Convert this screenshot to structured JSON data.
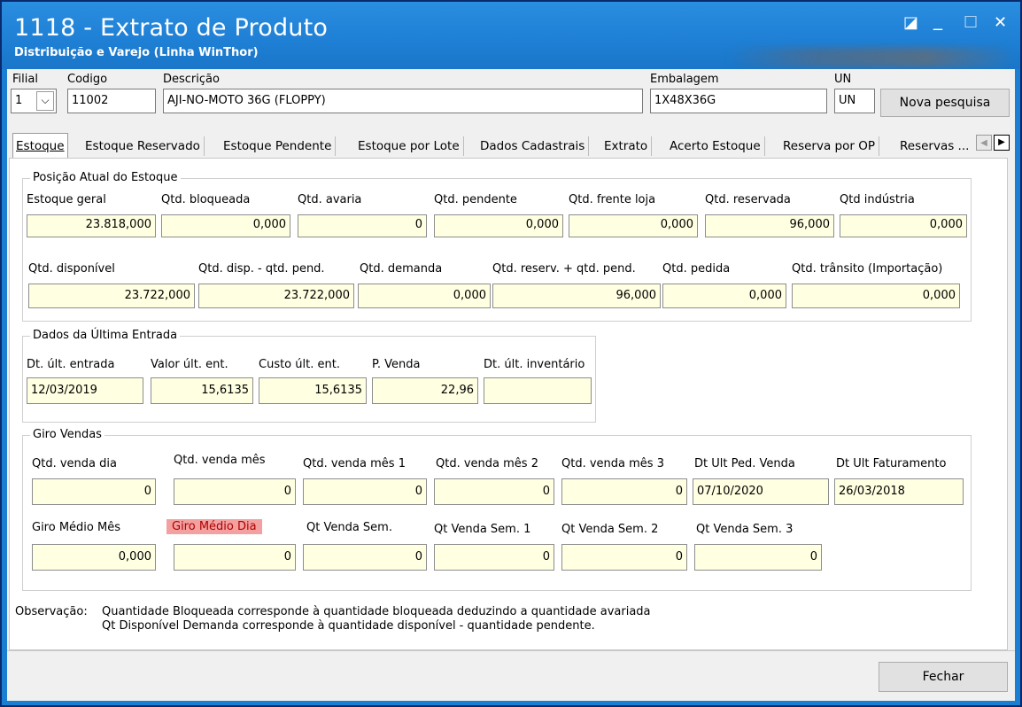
{
  "window": {
    "title": "1118 - Extrato de Produto",
    "subtitle": "Distribuição e Varejo (Linha WinThor)",
    "controls": {
      "restore": "◪",
      "minimize": "_",
      "maximize": "☐",
      "close": "✕"
    }
  },
  "header": {
    "filial": {
      "label": "Filial",
      "value": "1",
      "dropdown_glyph": "⌵"
    },
    "codigo": {
      "label": "Codigo",
      "value": "11002"
    },
    "descricao": {
      "label": "Descrição",
      "value": "AJI-NO-MOTO 36G (FLOPPY)"
    },
    "embalagem": {
      "label": "Embalagem",
      "value": "1X48X36G"
    },
    "un": {
      "label": "UN",
      "value": "UN"
    },
    "nova_pesquisa": "Nova pesquisa"
  },
  "tabs": [
    {
      "label": "Estoque",
      "active": true
    },
    {
      "label": "Estoque Reservado"
    },
    {
      "label": "Estoque Pendente"
    },
    {
      "label": "Estoque por Lote"
    },
    {
      "label": "Dados Cadastrais"
    },
    {
      "label": "Extrato"
    },
    {
      "label": "Acerto Estoque"
    },
    {
      "label": "Reserva por OP"
    },
    {
      "label": "Reservas ..."
    }
  ],
  "tab_scroll": {
    "left": "◀",
    "right": "▶"
  },
  "posicao": {
    "title": "Posição Atual do Estoque",
    "row1": [
      {
        "label": "Estoque geral",
        "value": "23.818,000"
      },
      {
        "label": "Qtd. bloqueada",
        "value": "0,000"
      },
      {
        "label": "Qtd. avaria",
        "value": "0"
      },
      {
        "label": "Qtd. pendente",
        "value": "0,000"
      },
      {
        "label": "Qtd. frente loja",
        "value": "0,000"
      },
      {
        "label": "Qtd. reservada",
        "value": "96,000"
      },
      {
        "label": "Qtd indústria",
        "value": "0,000"
      }
    ],
    "row2": [
      {
        "label": "Qtd. disponível",
        "value": "23.722,000"
      },
      {
        "label": "Qtd. disp. - qtd. pend.",
        "value": "23.722,000"
      },
      {
        "label": "Qtd. demanda",
        "value": "0,000"
      },
      {
        "label": "Qtd. reserv. + qtd. pend.",
        "value": "96,000"
      },
      {
        "label": "Qtd. pedida",
        "value": "0,000"
      },
      {
        "label": "Qtd. trânsito (Importação)",
        "value": "0,000"
      }
    ]
  },
  "ultima_entrada": {
    "title": "Dados da Última Entrada",
    "fields": [
      {
        "label": "Dt. últ. entrada",
        "value": "12/03/2019"
      },
      {
        "label": "Valor últ. ent.",
        "value": "15,6135"
      },
      {
        "label": "Custo últ. ent.",
        "value": "15,6135"
      },
      {
        "label": "P. Venda",
        "value": "22,96"
      },
      {
        "label": "Dt. últ. inventário",
        "value": ""
      }
    ]
  },
  "giro": {
    "title": "Giro Vendas",
    "row1": [
      {
        "label": "Qtd. venda dia",
        "value": "0"
      },
      {
        "label": "Qtd. venda mês",
        "value": "0"
      },
      {
        "label": "Qtd. venda mês 1",
        "value": "0"
      },
      {
        "label": "Qtd. venda mês 2",
        "value": "0"
      },
      {
        "label": "Qtd. venda mês 3",
        "value": "0"
      },
      {
        "label": "Dt Ult Ped. Venda",
        "value": "07/10/2020"
      },
      {
        "label": "Dt Ult Faturamento",
        "value": "26/03/2018"
      }
    ],
    "row2": [
      {
        "label": "Giro Médio Mês",
        "value": "0,000"
      },
      {
        "label": "Giro Médio Dia",
        "value": "0",
        "highlight_color": "#f3a0a0"
      },
      {
        "label": "Qt Venda Sem.",
        "value": "0"
      },
      {
        "label": "Qt Venda Sem. 1",
        "value": "0"
      },
      {
        "label": "Qt Venda Sem. 2",
        "value": "0"
      },
      {
        "label": "Qt Venda Sem. 3",
        "value": "0"
      }
    ]
  },
  "observacao": {
    "label": "Observação:",
    "line1": "Quantidade Bloqueada corresponde à quantidade bloqueada deduzindo a quantidade avariada",
    "line2": "Qt Disponível Demanda corresponde à quantidade disponível - quantidade pendente."
  },
  "footer": {
    "fechar": "Fechar"
  },
  "colors": {
    "titlebar": "#1e7fd4",
    "readonly_field": "#ffffe1",
    "highlight": "#f3a0a0"
  }
}
